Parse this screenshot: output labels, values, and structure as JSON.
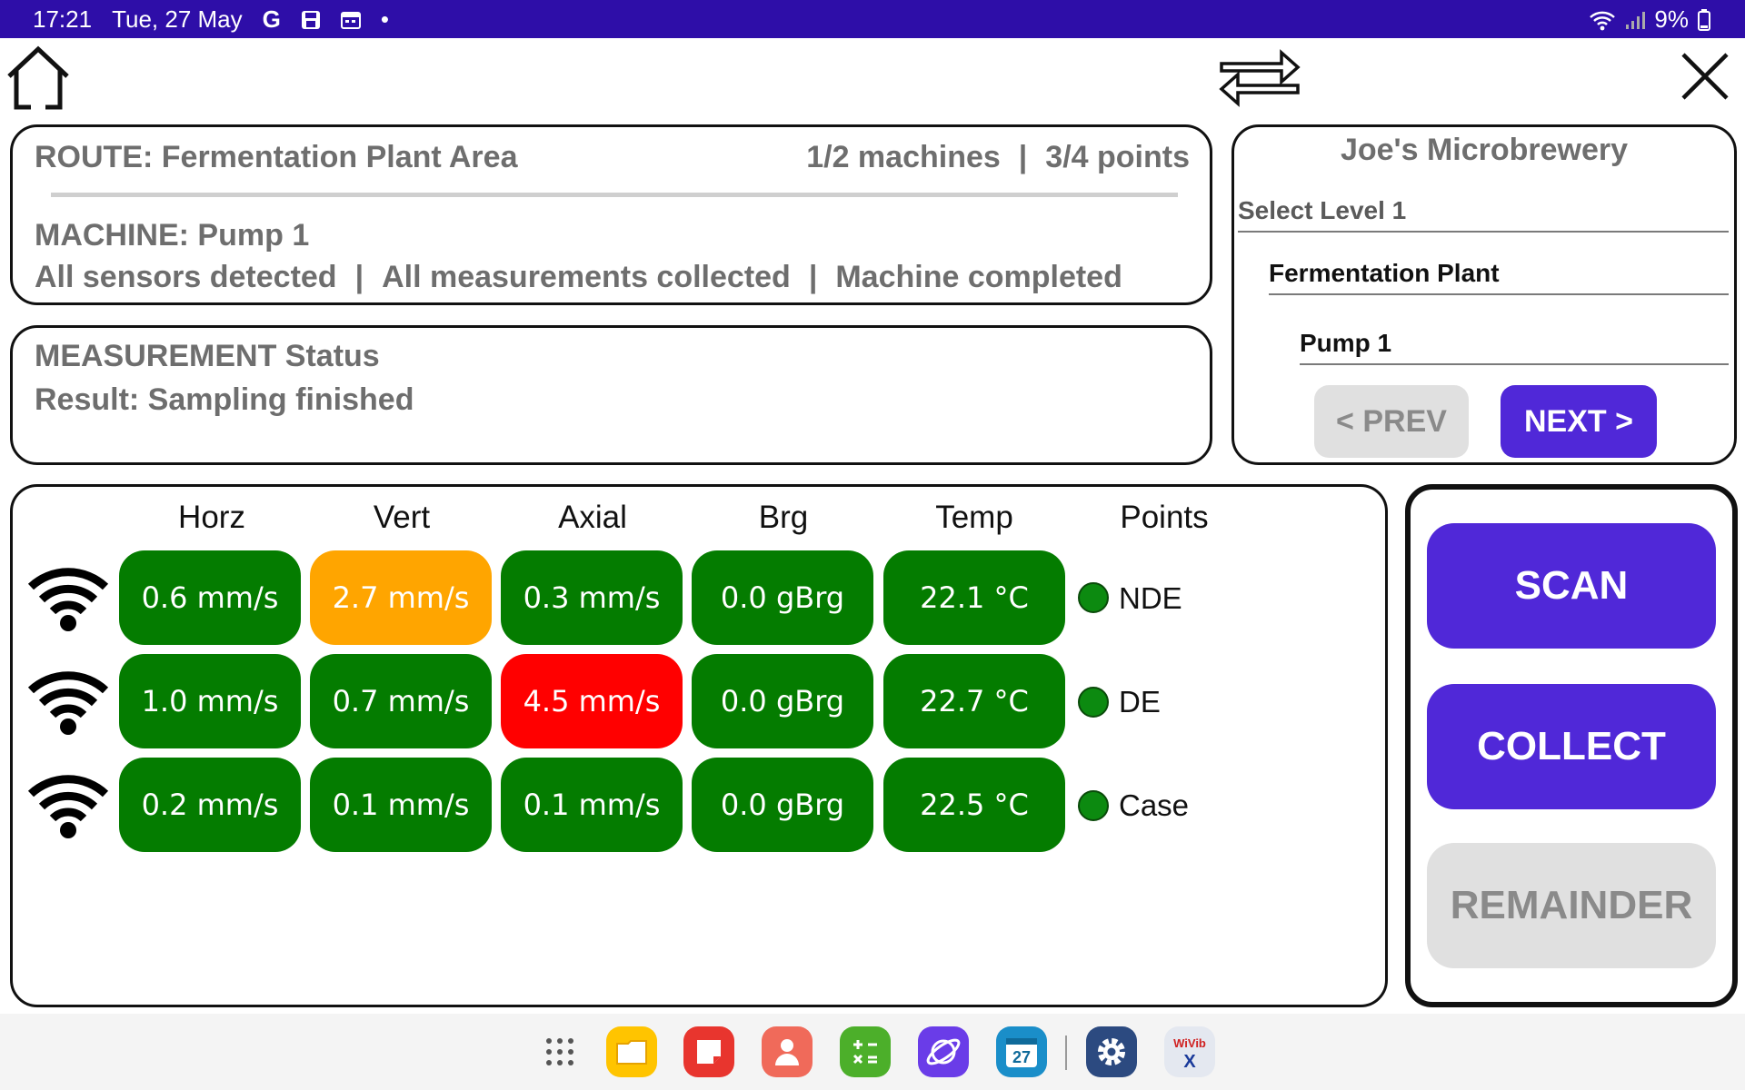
{
  "status_bar": {
    "time": "17:21",
    "date": "Tue, 27 May",
    "google_glyph": "G",
    "dot": "•",
    "battery": "9%"
  },
  "route": {
    "title": "ROUTE: Fermentation Plant Area",
    "machines": "1/2 machines",
    "separator": "|",
    "points": "3/4 points"
  },
  "machine": {
    "title": "MACHINE: Pump 1",
    "status_1": "All sensors detected",
    "status_2": "All measurements collected",
    "status_3": "Machine completed",
    "separator": "|"
  },
  "measurement": {
    "title": "MEASUREMENT Status",
    "result": "Result: Sampling finished"
  },
  "location": {
    "company": "Joe's Microbrewery",
    "level_label": "Select Level 1",
    "level_1": "Fermentation Plant",
    "level_2": "Pump 1",
    "prev_label": "< PREV",
    "next_label": "NEXT >"
  },
  "grid": {
    "headers": {
      "horz": "Horz",
      "vert": "Vert",
      "axial": "Axial",
      "brg": "Brg",
      "temp": "Temp",
      "points": "Points"
    },
    "rows": [
      {
        "horz": "0.6 mm/s",
        "vert": "2.7 mm/s",
        "axial": "0.3 mm/s",
        "brg": "0.0 gBrg",
        "temp": "22.1 °C",
        "point": "NDE"
      },
      {
        "horz": "1.0 mm/s",
        "vert": "0.7 mm/s",
        "axial": "4.5 mm/s",
        "brg": "0.0 gBrg",
        "temp": "22.7 °C",
        "point": "DE"
      },
      {
        "horz": "0.2 mm/s",
        "vert": "0.1 mm/s",
        "axial": "0.1 mm/s",
        "brg": "0.0 gBrg",
        "temp": "22.5 °C",
        "point": "Case"
      }
    ]
  },
  "colors": {
    "ok": "#047c00",
    "warning": "#ffa500",
    "alarm": "#ff0000",
    "accent": "#5028d8"
  },
  "actions": {
    "scan": "SCAN",
    "collect": "COLLECT",
    "remainder": "REMAINDER"
  },
  "dock": {
    "calendar_day": "27",
    "wivib_top": "WiVib",
    "wivib_bottom": "X"
  }
}
